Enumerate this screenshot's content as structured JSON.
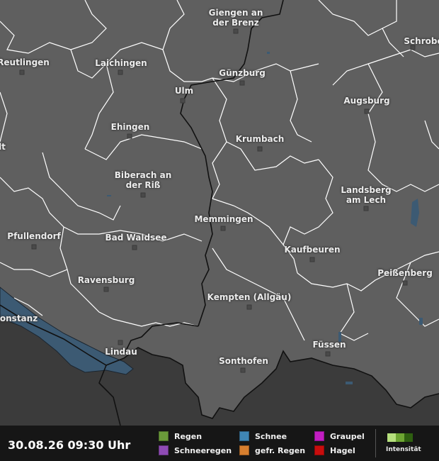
{
  "map": {
    "background_color": "#5f5f5f",
    "border_color": "#ffffff",
    "national_border_color": "#111111",
    "water_color": "#3c5a73",
    "foreign_color": "#3b3b3b",
    "cities": [
      {
        "name": "Giengen an\nder Brenz"
      },
      {
        "name": "Reutlingen"
      },
      {
        "name": "Laichingen"
      },
      {
        "name": "Schrobe"
      },
      {
        "name": "Günzburg"
      },
      {
        "name": "Ulm"
      },
      {
        "name": "Augsburg"
      },
      {
        "name": "Ehingen"
      },
      {
        "name": "Krumbach"
      },
      {
        "name": "Biberach an\nder Riß"
      },
      {
        "name": "Landsberg\nam Lech"
      },
      {
        "name": "Memmingen"
      },
      {
        "name": "Pfullendorf"
      },
      {
        "name": "Bad Waldsee"
      },
      {
        "name": "Kaufbeuren"
      },
      {
        "name": "Peißenberg"
      },
      {
        "name": "Ravensburg"
      },
      {
        "name": "Kempten (Allgäu)"
      },
      {
        "name": "Konstanz"
      },
      {
        "name": "Füssen"
      },
      {
        "name": "Lindau"
      },
      {
        "name": "Sonthofen"
      },
      {
        "name": "lt"
      }
    ]
  },
  "legend": {
    "timestamp": "30.08.26 09:30 Uhr",
    "items": [
      {
        "label": "Regen",
        "color": "#6a9a3a"
      },
      {
        "label": "Schnee",
        "color": "#3f86b5"
      },
      {
        "label": "Graupel",
        "color": "#c21ec2"
      },
      {
        "label": "Schneeregen",
        "color": "#8e4bb4"
      },
      {
        "label": "gefr. Regen",
        "color": "#d77f2f"
      },
      {
        "label": "Hagel",
        "color": "#c80d0d"
      }
    ],
    "intensity_label": "Intensität",
    "intensity_colors": [
      "#b6e07d",
      "#6da532",
      "#2e5f10"
    ]
  }
}
